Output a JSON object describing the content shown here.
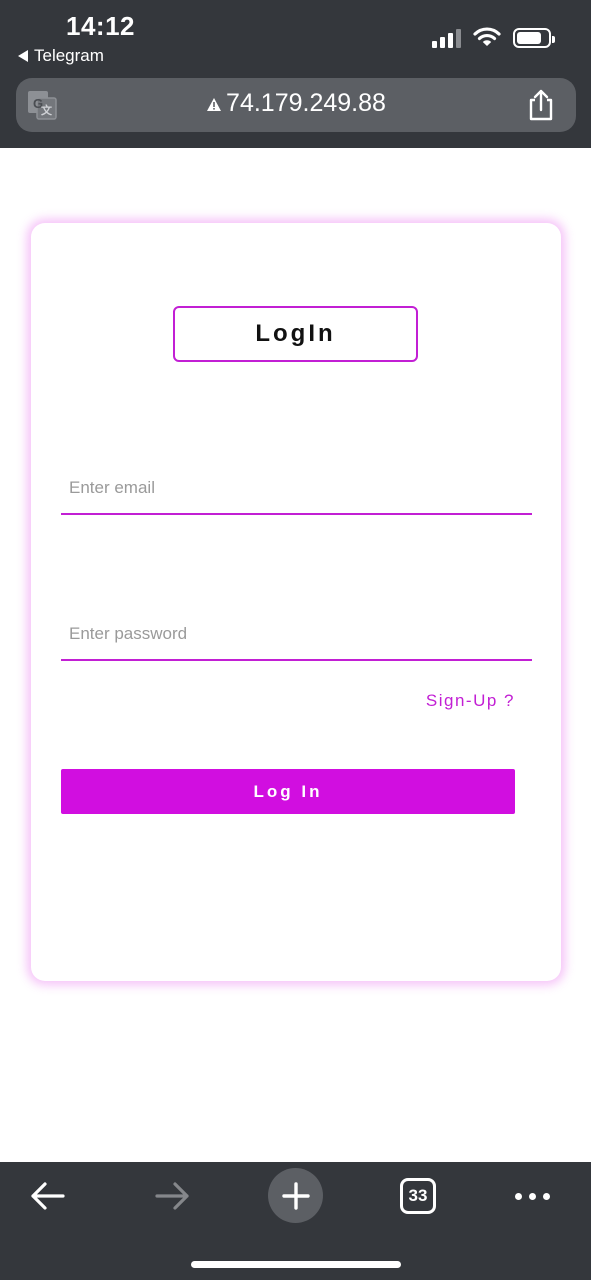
{
  "status_bar": {
    "time": "14:12",
    "back_app_label": "Telegram",
    "icons": [
      "cellular-signal-icon",
      "wifi-icon",
      "battery-icon"
    ]
  },
  "browser": {
    "url": "74.179.249.88",
    "security_icon": "warning-triangle-icon",
    "translate_icon": "translate-icon",
    "share_icon": "share-icon"
  },
  "login_card": {
    "title": "LogIn",
    "email_placeholder": "Enter email",
    "password_placeholder": "Enter password",
    "signup_link": "Sign-Up ?",
    "login_button": "Log In",
    "accent_color": "#d10ee0"
  },
  "toolbar": {
    "tab_count": "33",
    "icons": [
      "back-arrow-icon",
      "forward-arrow-icon",
      "new-tab-plus-icon",
      "tabs-icon",
      "more-icon"
    ]
  }
}
